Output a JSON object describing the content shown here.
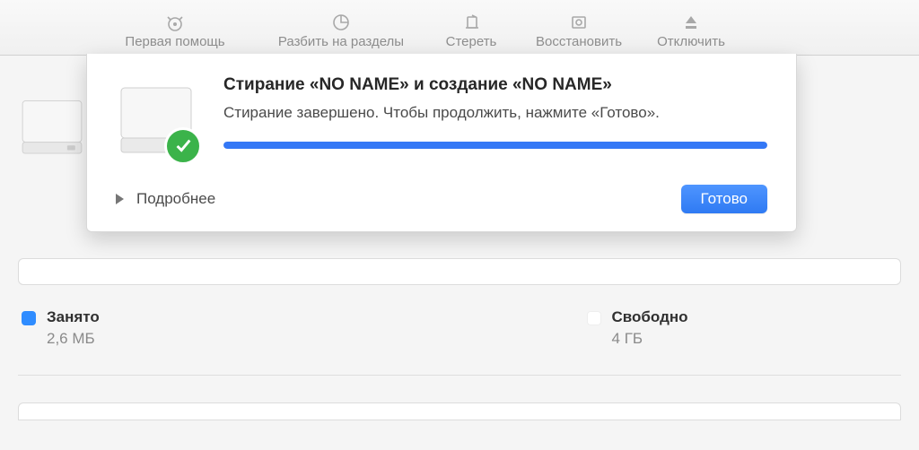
{
  "toolbar": {
    "items": [
      {
        "label": "Первая помощь"
      },
      {
        "label": "Разбить на разделы"
      },
      {
        "label": "Стереть"
      },
      {
        "label": "Восстановить"
      },
      {
        "label": "Отключить"
      }
    ]
  },
  "sheet": {
    "title": "Стирание «NO NAME» и создание «NO NAME»",
    "subtitle": "Стирание завершено. Чтобы продолжить, нажмите «Готово».",
    "details_label": "Подробнее",
    "done_label": "Готово",
    "progress_percent": 100
  },
  "usage": {
    "used": {
      "label": "Занято",
      "value": "2,6 МБ",
      "color": "#2f8cff"
    },
    "free": {
      "label": "Свободно",
      "value": "4 ГБ",
      "color": "#ffffff"
    }
  }
}
